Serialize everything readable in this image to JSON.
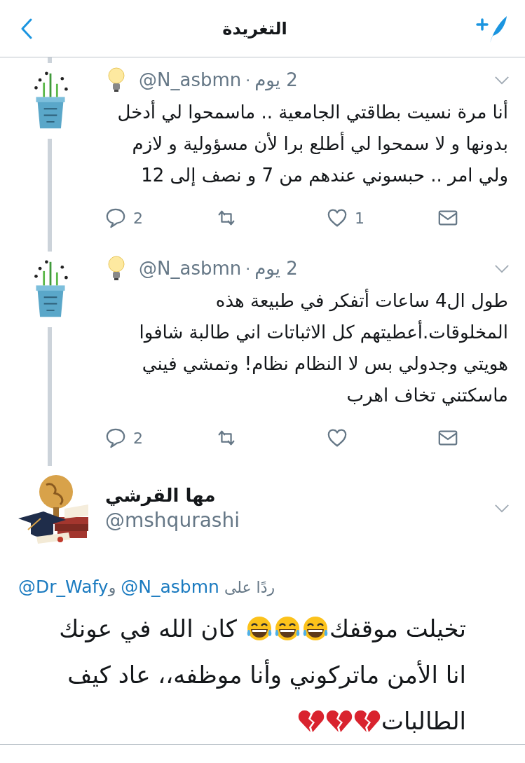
{
  "header": {
    "title": "التغريدة"
  },
  "thread": [
    {
      "handle": "@N_asbmn",
      "separator": "·",
      "time": "2 يوم",
      "text": "أنا مرة نسيت بطاقتي الجامعية .. ماسمحوا لي أدخل بدونها و لا سمحوا لي أطلع برا لأن مسؤولية و لازم ولي امر .. حبسوني عندهم من 7 و نصف إلى 12",
      "replies": "2",
      "likes": "1"
    },
    {
      "handle": "@N_asbmn",
      "separator": "·",
      "time": "2 يوم",
      "text": "طول ال4 ساعات أتفكر في طبيعة هذه المخلوقات.أعطيتهم كل الاثباتات اني طالبة شافوا هويتي وجدولي بس لا النظام نظام! وتمشي فيني ماسكتني تخاف اهرب",
      "replies": "2"
    }
  ],
  "main_tweet": {
    "name": "مها القرشي",
    "handle": "@mshqurashi",
    "reply_to": {
      "prefix": "ردًا على",
      "joiner": "و",
      "handles": [
        "@N_asbmn",
        "@Dr_Wafy"
      ]
    },
    "body_lines": [
      [
        {
          "kind": "text",
          "text": "تخيلت موقفك"
        },
        {
          "kind": "laugh"
        },
        {
          "kind": "laugh"
        },
        {
          "kind": "laugh"
        },
        {
          "kind": "text",
          "text": "كان الله في عونك"
        }
      ],
      [
        {
          "kind": "text",
          "text": "انا الأمن ماتركوني وأنا موظفه،، عاد كيف"
        }
      ],
      [
        {
          "kind": "text",
          "text": "الطالبات"
        },
        {
          "kind": "heartbreak"
        },
        {
          "kind": "heartbreak"
        },
        {
          "kind": "heartbreak"
        }
      ]
    ]
  }
}
